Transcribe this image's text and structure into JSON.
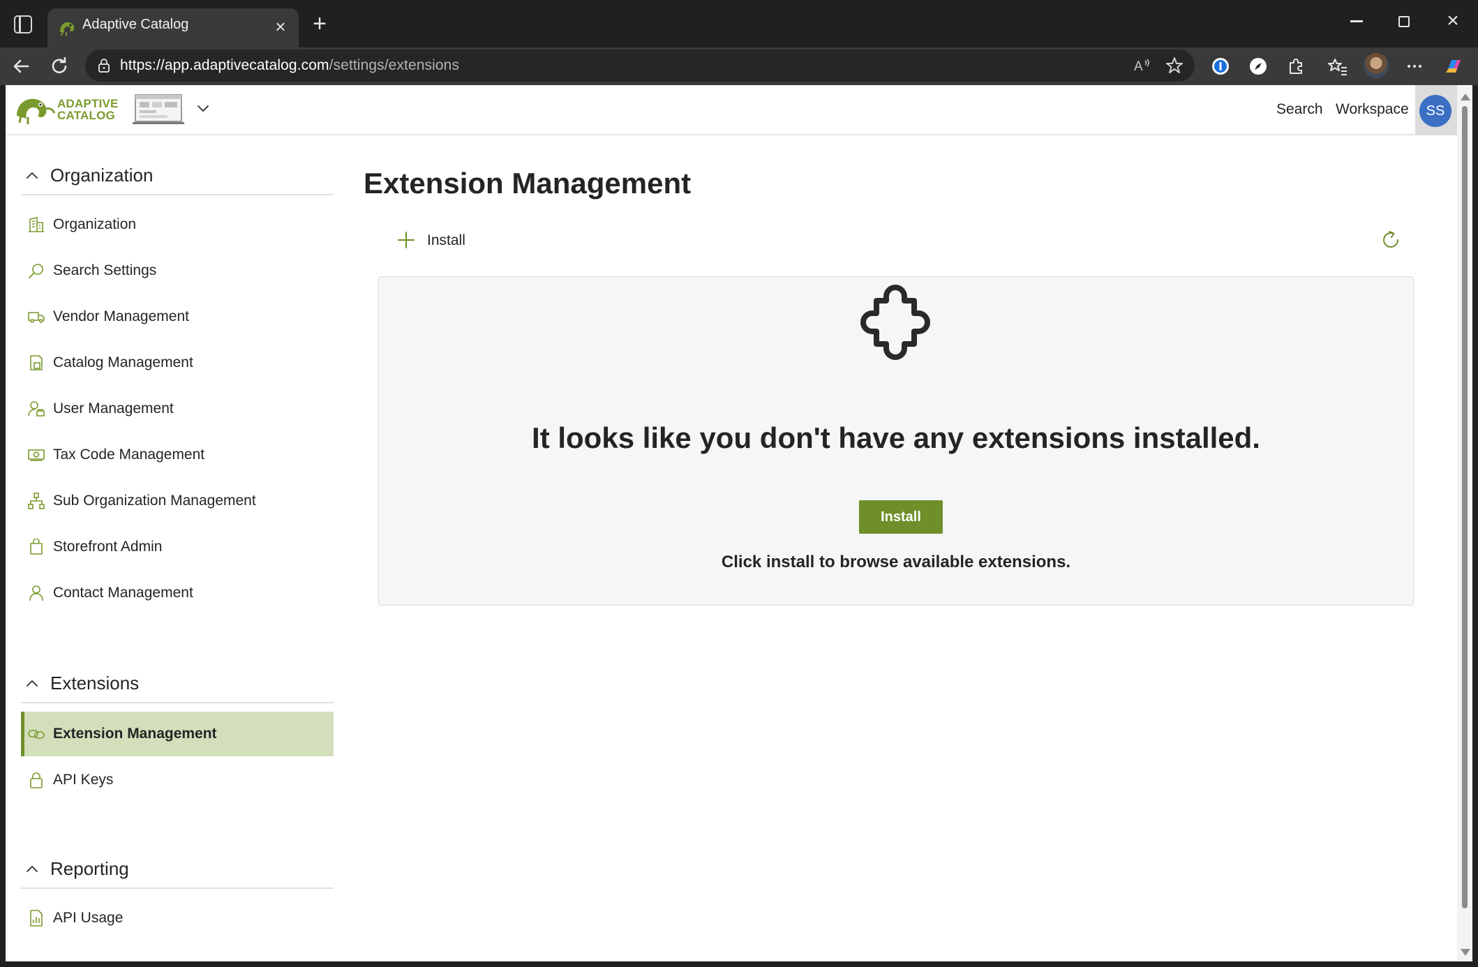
{
  "browser": {
    "tab_title": "Adaptive Catalog",
    "url_host": "https://app.adaptivecatalog.com",
    "url_path": "/settings/extensions"
  },
  "header": {
    "logo_line1": "ADAPTIVE",
    "logo_line2": "CATALOG",
    "search_label": "Search",
    "workspace_label": "Workspace",
    "user_initials": "SS"
  },
  "sidebar": {
    "sections": [
      {
        "title": "Organization",
        "items": [
          {
            "label": "Organization",
            "icon": "building-icon"
          },
          {
            "label": "Search Settings",
            "icon": "search-icon"
          },
          {
            "label": "Vendor Management",
            "icon": "truck-icon"
          },
          {
            "label": "Catalog Management",
            "icon": "catalog-icon"
          },
          {
            "label": "User Management",
            "icon": "user-settings-icon"
          },
          {
            "label": "Tax Code Management",
            "icon": "money-icon"
          },
          {
            "label": "Sub Organization Management",
            "icon": "org-chart-icon"
          },
          {
            "label": "Storefront Admin",
            "icon": "shopping-bag-icon"
          },
          {
            "label": "Contact Management",
            "icon": "person-icon"
          }
        ]
      },
      {
        "title": "Extensions",
        "items": [
          {
            "label": "Extension Management",
            "icon": "link-icon",
            "active": true
          },
          {
            "label": "API Keys",
            "icon": "lock-icon"
          }
        ]
      },
      {
        "title": "Reporting",
        "items": [
          {
            "label": "API Usage",
            "icon": "report-icon"
          }
        ]
      }
    ]
  },
  "main": {
    "title": "Extension Management",
    "install_command": "Install",
    "empty_title": "It looks like you don't have any extensions installed.",
    "install_button": "Install",
    "empty_subtitle": "Click install to browse available extensions."
  },
  "colors": {
    "brand_green": "#6f8f2a",
    "active_nav_bg": "#d3dfbb",
    "avatar_blue": "#3a6fc4"
  }
}
